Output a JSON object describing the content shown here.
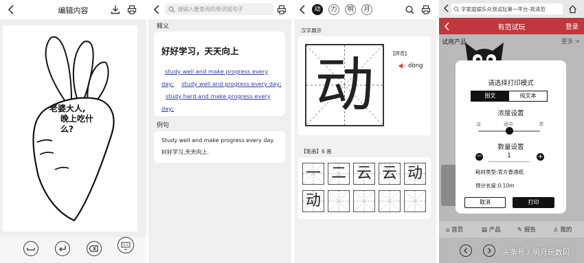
{
  "panel1": {
    "title": "编辑内容",
    "note_text": [
      "老婆大人,",
      "晚上吃什",
      "么?"
    ]
  },
  "panel2": {
    "search_placeholder": "请输入要查询的单词或句子",
    "section_definition": "释义",
    "headword": "好好学习，天天向上",
    "translations": [
      "study well and make progress every day;",
      "study well and progress every day;",
      "study hard and make progress every day;"
    ],
    "section_example": "例句",
    "example_en": "Study well and make progress every day.",
    "example_zh": "好好学习,天天向上."
  },
  "panel3": {
    "tabs": [
      "动",
      "力",
      "明",
      "月"
    ],
    "section_char": "汉字展示",
    "character": "动",
    "pinyin_label": "【拼音】",
    "pinyin": "dòng",
    "strokes_label": "【笔画】6 画",
    "strokes": [
      "一",
      "二",
      "云",
      "云",
      "动",
      "动",
      "",
      "",
      "",
      ""
    ]
  },
  "panel4": {
    "url": "字家庭娱乐众测试玩第一平台-高清范",
    "app_title": "有范试玩",
    "login": "登录",
    "trial_label": "试用产品",
    "more": "更多 >",
    "dialog": {
      "title": "请选择打印模式",
      "mode_graphic": "图文",
      "mode_text": "纯文本",
      "density_title": "浓度设置",
      "density_labels": [
        "淡",
        "适中",
        "浓"
      ],
      "density_value": 0.5,
      "quantity_title": "数量设置",
      "quantity": "1",
      "material": "耗材类型:官方普通纸",
      "length": "预计长度:0.10m",
      "cancel": "取消",
      "print": "打印"
    },
    "bottom_nav": [
      "首页",
      "产品",
      "报告",
      "我的"
    ],
    "watermark": "头条号 / 明月玩数码"
  },
  "colors": {
    "accent_red": "#c0373d",
    "dark": "#111111",
    "link_blue": "#2f3aa8"
  }
}
